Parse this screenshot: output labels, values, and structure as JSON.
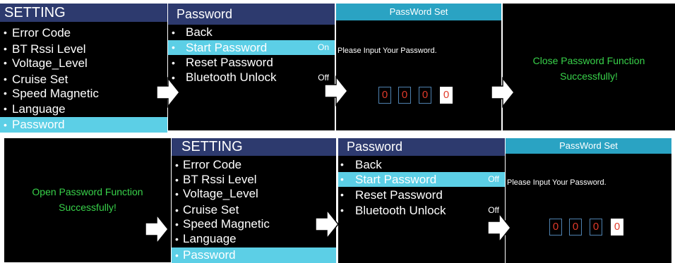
{
  "setting_menu": {
    "title": "SETTING",
    "items": [
      "Error Code",
      "BT Rssi Level",
      "Voltage_Level",
      "Cruise Set",
      "Speed Magnetic",
      "Language",
      "Password"
    ],
    "selected": "Password"
  },
  "password_menu": {
    "title": "Password",
    "items": [
      {
        "label": "Back",
        "state": ""
      },
      {
        "label": "Start Password",
        "state": "On"
      },
      {
        "label": "Reset Password",
        "state": ""
      },
      {
        "label": "Bluetooth Unlock",
        "state": "Off"
      }
    ],
    "bottom_items": [
      {
        "label": "Back",
        "state": ""
      },
      {
        "label": "Start Password",
        "state": "Off"
      },
      {
        "label": "Reset Password",
        "state": ""
      },
      {
        "label": "Bluetooth Unlock",
        "state": "Off"
      }
    ],
    "selected": "Start Password"
  },
  "password_set": {
    "title": "PassWord Set",
    "prompt": "Please Input Your Password.",
    "digits": [
      "0",
      "0",
      "0",
      "0"
    ]
  },
  "messages": {
    "close_line1": "Close Password Function",
    "close_line2": "Successfully!",
    "open_line1": "Open Password Function",
    "open_line2": "Successfully!"
  },
  "colors": {
    "header_navy": "#2d3a6e",
    "header_cyan": "#2aa3c3",
    "selection": "#5ccfe6",
    "success_text": "#38d24a",
    "digit_text": "#e03a2a"
  },
  "icons": {
    "flow_arrow": "right-arrow-icon"
  }
}
